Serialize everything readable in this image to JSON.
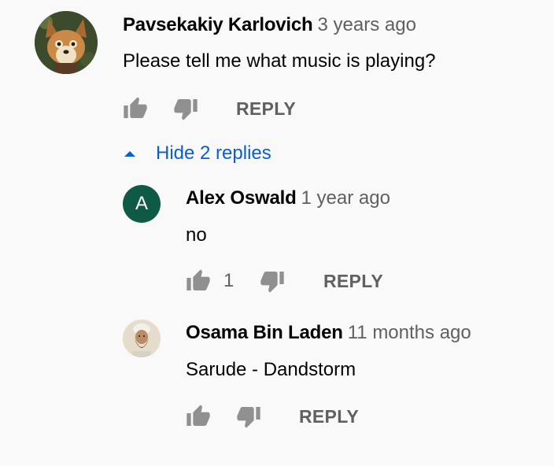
{
  "comment": {
    "author": "Pavsekakiy Karlovich",
    "time": "3 years ago",
    "text": "Please tell me what music is playing?",
    "reply_label": "REPLY",
    "avatar_icon": "fox-avatar-icon"
  },
  "toggle": {
    "label": "Hide 2 replies"
  },
  "replies": [
    {
      "author": "Alex Oswald",
      "time": "1 year ago",
      "text": "no",
      "likes": "1",
      "avatar_letter": "A",
      "reply_label": "REPLY"
    },
    {
      "author": "Osama Bin Laden",
      "time": "11 months ago",
      "text": "Sarude - Dandstorm",
      "reply_label": "REPLY",
      "avatar_icon": "bearded-man-avatar-icon"
    }
  ],
  "colors": {
    "background": "#f9f9f9",
    "link": "#065fd4",
    "secondary": "#606060",
    "icon": "#909090",
    "letter_avatar": "#0f5a47"
  }
}
